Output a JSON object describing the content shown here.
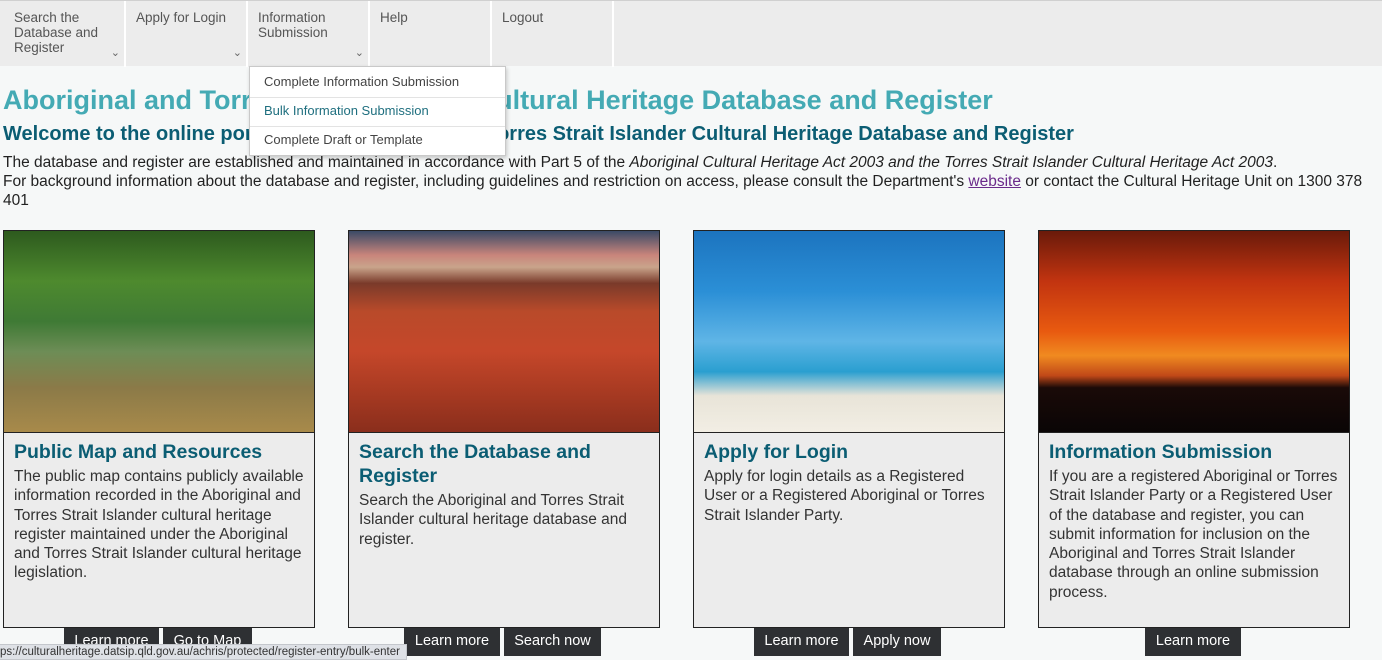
{
  "nav": {
    "items": [
      {
        "label": "Search the\nDatabase and\nRegister",
        "chevron": true
      },
      {
        "label": "Apply for Login",
        "chevron": true
      },
      {
        "label": "Information\nSubmission",
        "chevron": true
      },
      {
        "label": "Help",
        "chevron": false
      },
      {
        "label": "Logout",
        "chevron": false
      }
    ],
    "dropdown": [
      "Complete Information Submission",
      "Bulk Information Submission",
      "Complete Draft or Template"
    ]
  },
  "page": {
    "title": "Aboriginal and Torres Strait Islander Cultural Heritage Database and Register",
    "subtitle": "Welcome to the online portal of the Aboriginal and Torres Strait Islander Cultural Heritage Database and Register",
    "intro_line1_a": "The database and register are established and maintained in accordance with Part 5 of the ",
    "intro_line1_em": "Aboriginal Cultural Heritage Act 2003 and the Torres Strait Islander Cultural Heritage Act 2003",
    "intro_line1_b": ".",
    "intro_line2_a": "For background information about the database and register, including guidelines and restriction on access, please consult the Department's ",
    "intro_link": "website",
    "intro_line2_b": " or contact the Cultural Heritage Unit on 1300 378 401"
  },
  "cards": [
    {
      "title": "Public Map and Resources",
      "desc": "The public map contains publicly available information recorded in the Aboriginal and Torres Strait Islander cultural heritage register maintained under the Aboriginal and Torres Strait Islander cultural heritage legislation."
    },
    {
      "title": "Search the Database and Register",
      "desc": "Search the Aboriginal and Torres Strait Islander cultural heritage database and register."
    },
    {
      "title": "Apply for Login",
      "desc": "Apply for login details as a Registered User or a Registered Aboriginal or Torres Strait Islander Party."
    },
    {
      "title": "Information Submission",
      "desc": "If you are a registered Aboriginal or Torres Strait Islander Party or a Registered User of the database and register, you can submit information for inclusion on the Aboriginal and Torres Strait Islander database through an online submission process."
    }
  ],
  "buttons": {
    "learn_more": "Learn more",
    "go_to_map": "Go to Map",
    "search_now": "Search now",
    "apply_now": "Apply now"
  },
  "statusbar": "ps://culturalheritage.datsip.qld.gov.au/achris/protected/register-entry/bulk-enter"
}
